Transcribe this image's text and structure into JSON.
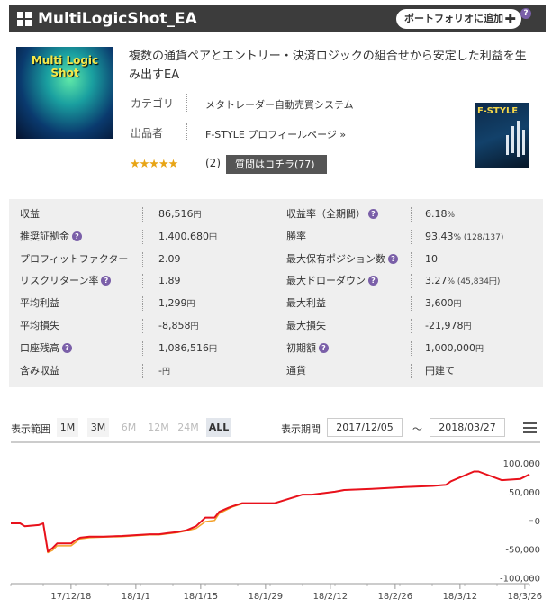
{
  "header": {
    "title": "MultiLogicShot_EA",
    "portfolio_button": "ポートフォリオに追加",
    "portfolio_icon": "plus-icon",
    "help_glyph": "?"
  },
  "product": {
    "image_text": "Multi Logic Shot",
    "description": "複数の通貨ペアとエントリー・決済ロジックの組合せから安定した利益を生み出すEA",
    "category_label": "カテゴリ",
    "category_value": "メタトレーダー自動売買システム",
    "seller_label": "出品者",
    "seller_value": "F-STYLE プロフィールページ »",
    "rating_stars": "★★★★★",
    "rating": 5,
    "review_count": "(2)",
    "question_button": "質問はコチラ(77)",
    "thumb_text": "F-STYLE"
  },
  "stats": {
    "rows": [
      {
        "l1": "収益",
        "q1": false,
        "v1": "86,516",
        "u1": "円",
        "l2": "収益率（全期間）",
        "q2": true,
        "v2": "6.18",
        "u2": "%"
      },
      {
        "l1": "推奨証拠金",
        "q1": true,
        "v1": "1,400,680",
        "u1": "円",
        "l2": "勝率",
        "q2": false,
        "v2": "93.43",
        "u2": "% (128/137)"
      },
      {
        "l1": "プロフィットファクター",
        "q1": false,
        "v1": "2.09",
        "u1": "",
        "l2": "最大保有ポジション数",
        "q2": true,
        "v2": "10",
        "u2": ""
      },
      {
        "l1": "リスクリターン率",
        "q1": true,
        "v1": "1.89",
        "u1": "",
        "l2": "最大ドローダウン",
        "q2": true,
        "v2": "3.27",
        "u2": "% (45,834円)"
      },
      {
        "l1": "平均利益",
        "q1": false,
        "v1": "1,299",
        "u1": "円",
        "l2": "最大利益",
        "q2": false,
        "v2": "3,600",
        "u2": "円"
      },
      {
        "l1": "平均損失",
        "q1": false,
        "v1": "-8,858",
        "u1": "円",
        "l2": "最大損失",
        "q2": false,
        "v2": "-21,978",
        "u2": "円"
      },
      {
        "l1": "口座残高",
        "q1": true,
        "v1": "1,086,516",
        "u1": "円",
        "l2": "初期額",
        "q2": true,
        "v2": "1,000,000",
        "u2": "円"
      },
      {
        "l1": "含み収益",
        "q1": false,
        "v1": "-",
        "u1": "円",
        "l2": "通貨",
        "q2": false,
        "v2": "円建て",
        "u2": ""
      }
    ]
  },
  "chart_controls": {
    "range_label": "表示範囲",
    "ranges": [
      {
        "label": "1M",
        "state": "on"
      },
      {
        "label": "3M",
        "state": "on"
      },
      {
        "label": "6M",
        "state": "off"
      },
      {
        "label": "12M",
        "state": "off"
      },
      {
        "label": "24M",
        "state": "off"
      },
      {
        "label": "ALL",
        "state": "all"
      }
    ],
    "period_label": "表示期間",
    "date_from": "2017/12/05",
    "tilde": "～",
    "date_to": "2018/03/27",
    "menu_icon": "hamburger-menu-icon"
  },
  "chart_data": {
    "type": "line",
    "x_tick_labels": [
      "17/12/18",
      "18/1/1",
      "18/1/15",
      "18/1/29",
      "18/2/12",
      "18/2/26",
      "18/3/12",
      "18/3/26"
    ],
    "y_tick_labels": [
      "100,000",
      "50,000",
      "0",
      "-50,000",
      "-100,000"
    ],
    "y_ticks": [
      100000,
      50000,
      0,
      -50000,
      -100000
    ],
    "ylim": [
      -110000,
      125000
    ],
    "x_range": [
      "2017-12-05",
      "2018-03-27"
    ],
    "colors": {
      "profit": "#e8111c",
      "secondary": "#f3a12a"
    },
    "series": [
      {
        "x": [
          "2017-12-05",
          "2017-12-07",
          "2017-12-08",
          "2017-12-11",
          "2017-12-12",
          "2017-12-13",
          "2017-12-14",
          "2017-12-15",
          "2017-12-18",
          "2017-12-19",
          "2017-12-20",
          "2017-12-22",
          "2017-12-25",
          "2017-12-29",
          "2018-01-02",
          "2018-01-04",
          "2018-01-06",
          "2018-01-08",
          "2018-01-10",
          "2018-01-12",
          "2018-01-14",
          "2018-01-16",
          "2018-01-18",
          "2018-01-19",
          "2018-01-21",
          "2018-01-22",
          "2018-01-24",
          "2018-01-29",
          "2018-01-31",
          "2018-02-06",
          "2018-02-08",
          "2018-02-13",
          "2018-02-15",
          "2018-02-21",
          "2018-02-28",
          "2018-03-06",
          "2018-03-09",
          "2018-03-10",
          "2018-03-15",
          "2018-03-16",
          "2018-03-21",
          "2018-03-25",
          "2018-03-27"
        ],
        "values": [
          -5000,
          -5000,
          -10000,
          -8000,
          -5000,
          -54000,
          -48000,
          -40000,
          -40000,
          -34000,
          -30000,
          -28000,
          -28000,
          -27000,
          -25000,
          -24000,
          -24000,
          -22000,
          -20000,
          -17000,
          -10000,
          5000,
          5000,
          15000,
          22000,
          25000,
          30000,
          30000,
          30000,
          45000,
          45000,
          50000,
          53000,
          55000,
          58000,
          60000,
          62000,
          68000,
          85000,
          85000,
          70000,
          72000,
          80000
        ]
      },
      {
        "x": [
          "2017-12-05",
          "2017-12-07",
          "2017-12-08",
          "2017-12-11",
          "2017-12-12",
          "2017-12-13",
          "2017-12-14",
          "2017-12-15",
          "2017-12-18",
          "2017-12-19",
          "2017-12-20",
          "2017-12-22",
          "2017-12-25",
          "2017-12-29",
          "2018-01-02",
          "2018-01-04",
          "2018-01-06",
          "2018-01-08",
          "2018-01-10",
          "2018-01-12",
          "2018-01-14",
          "2018-01-16",
          "2018-01-18",
          "2018-01-19",
          "2018-01-21",
          "2018-01-22",
          "2018-01-24",
          "2018-01-29",
          "2018-01-31",
          "2018-02-06",
          "2018-02-08",
          "2018-02-13",
          "2018-02-15",
          "2018-02-21",
          "2018-02-28",
          "2018-03-06",
          "2018-03-09",
          "2018-03-10",
          "2018-03-15",
          "2018-03-16",
          "2018-03-21",
          "2018-03-25",
          "2018-03-27"
        ],
        "values": [
          -5000,
          -5000,
          -10000,
          -8000,
          -5000,
          -56000,
          -52000,
          -44000,
          -44000,
          -38000,
          -32000,
          -30000,
          -29000,
          -28000,
          -26000,
          -25000,
          -25000,
          -23000,
          -21000,
          -18000,
          -14000,
          -2000,
          0,
          12000,
          20000,
          24000,
          29000,
          29000,
          30000,
          45000,
          45000,
          50000,
          53000,
          55000,
          58000,
          60000,
          62000,
          68000,
          85000,
          85000,
          70000,
          72000,
          80000
        ]
      }
    ]
  }
}
